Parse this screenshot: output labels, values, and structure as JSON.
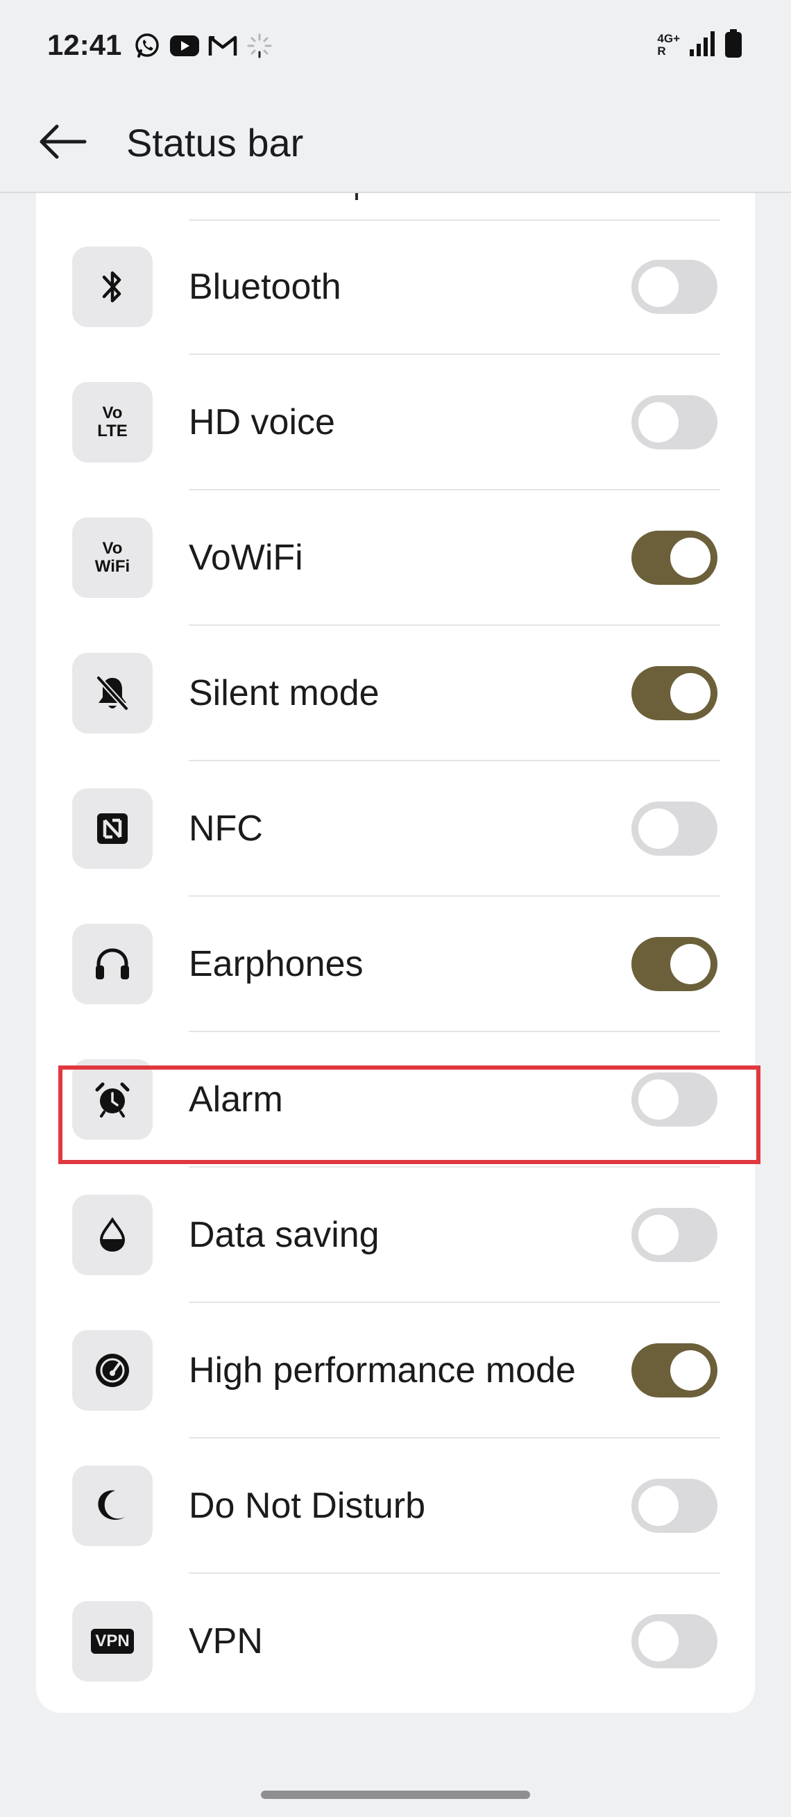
{
  "status_bar": {
    "time": "12:41",
    "network_top": "4G+",
    "network_bottom": "R",
    "notification_icons": [
      "whatsapp-icon",
      "youtube-icon",
      "gmail-icon",
      "loading-icon"
    ]
  },
  "app_bar": {
    "title": "Status bar"
  },
  "colors": {
    "toggle_on": "#6b603a",
    "toggle_off": "#dadadc",
    "highlight": "#e0383e"
  },
  "rows": [
    {
      "label": "Bluetooth",
      "icon": "bluetooth-icon",
      "on": false
    },
    {
      "label": "HD voice",
      "icon": "volte-icon",
      "icon_text_top": "Vo",
      "icon_text_bottom": "LTE",
      "on": false
    },
    {
      "label": "VoWiFi",
      "icon": "vowifi-icon",
      "icon_text_top": "Vo",
      "icon_text_bottom": "WiFi",
      "on": true
    },
    {
      "label": "Silent mode",
      "icon": "bell-off-icon",
      "on": true
    },
    {
      "label": "NFC",
      "icon": "nfc-icon",
      "on": false
    },
    {
      "label": "Earphones",
      "icon": "headphones-icon",
      "on": true
    },
    {
      "label": "Alarm",
      "icon": "alarm-clock-icon",
      "on": false
    },
    {
      "label": "Data saving",
      "icon": "water-drop-icon",
      "on": false
    },
    {
      "label": "High performance mode",
      "icon": "speedometer-icon",
      "on": true
    },
    {
      "label": "Do Not Disturb",
      "icon": "moon-icon",
      "on": false
    },
    {
      "label": "VPN",
      "icon": "vpn-icon",
      "icon_text": "VPN",
      "on": false
    }
  ]
}
